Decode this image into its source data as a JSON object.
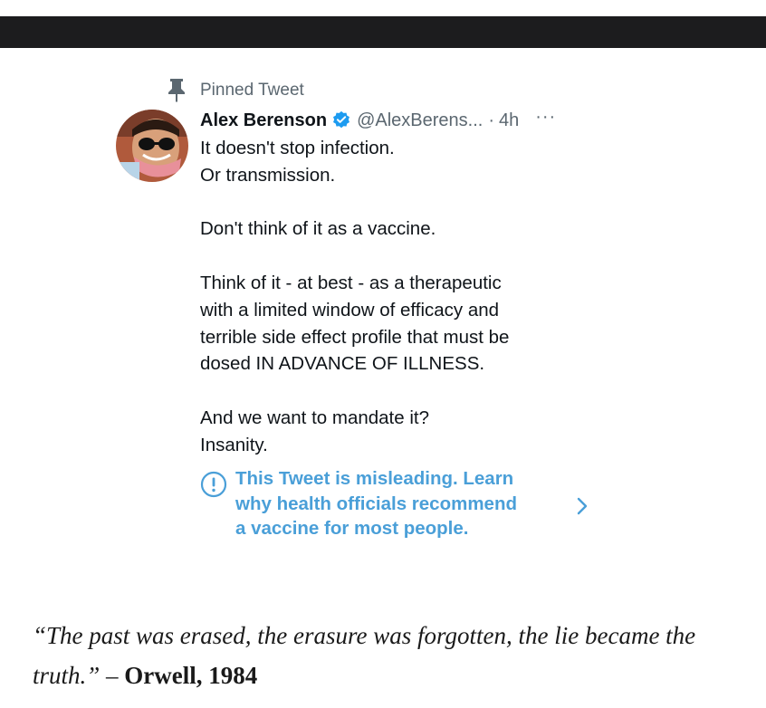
{
  "pinned": {
    "label": "Pinned Tweet",
    "icon": "pin-icon"
  },
  "tweet": {
    "display_name": "Alex Berenson",
    "verified_icon": "verified-badge-icon",
    "handle": "@AlexBerens...",
    "separator": "·",
    "time": "4h",
    "more_label": "···",
    "paragraphs": [
      [
        "It doesn't stop infection.",
        "Or transmission."
      ],
      [
        "Don't think of it as a vaccine."
      ],
      [
        "Think of it - at best - as a therapeutic",
        "with a limited window of efficacy and",
        "terrible side effect profile that must be",
        "dosed IN ADVANCE OF ILLNESS."
      ],
      [
        "And we want to mandate it?",
        "Insanity."
      ]
    ]
  },
  "notice": {
    "icon": "info-circle-icon",
    "lines": [
      "This Tweet is misleading. Learn",
      "why health officials recommend",
      "a vaccine for most people."
    ],
    "chevron_icon": "chevron-right-icon",
    "color": "#4a9fd8"
  },
  "quote": {
    "text": "“The past was erased, the erasure was forgotten, the lie became the truth.”",
    "dash": " – ",
    "author": "Orwell, 1984"
  },
  "colors": {
    "top_bar": "#1c1c1e",
    "verified": "#1d9bf0",
    "secondary_text": "#5b6770"
  }
}
